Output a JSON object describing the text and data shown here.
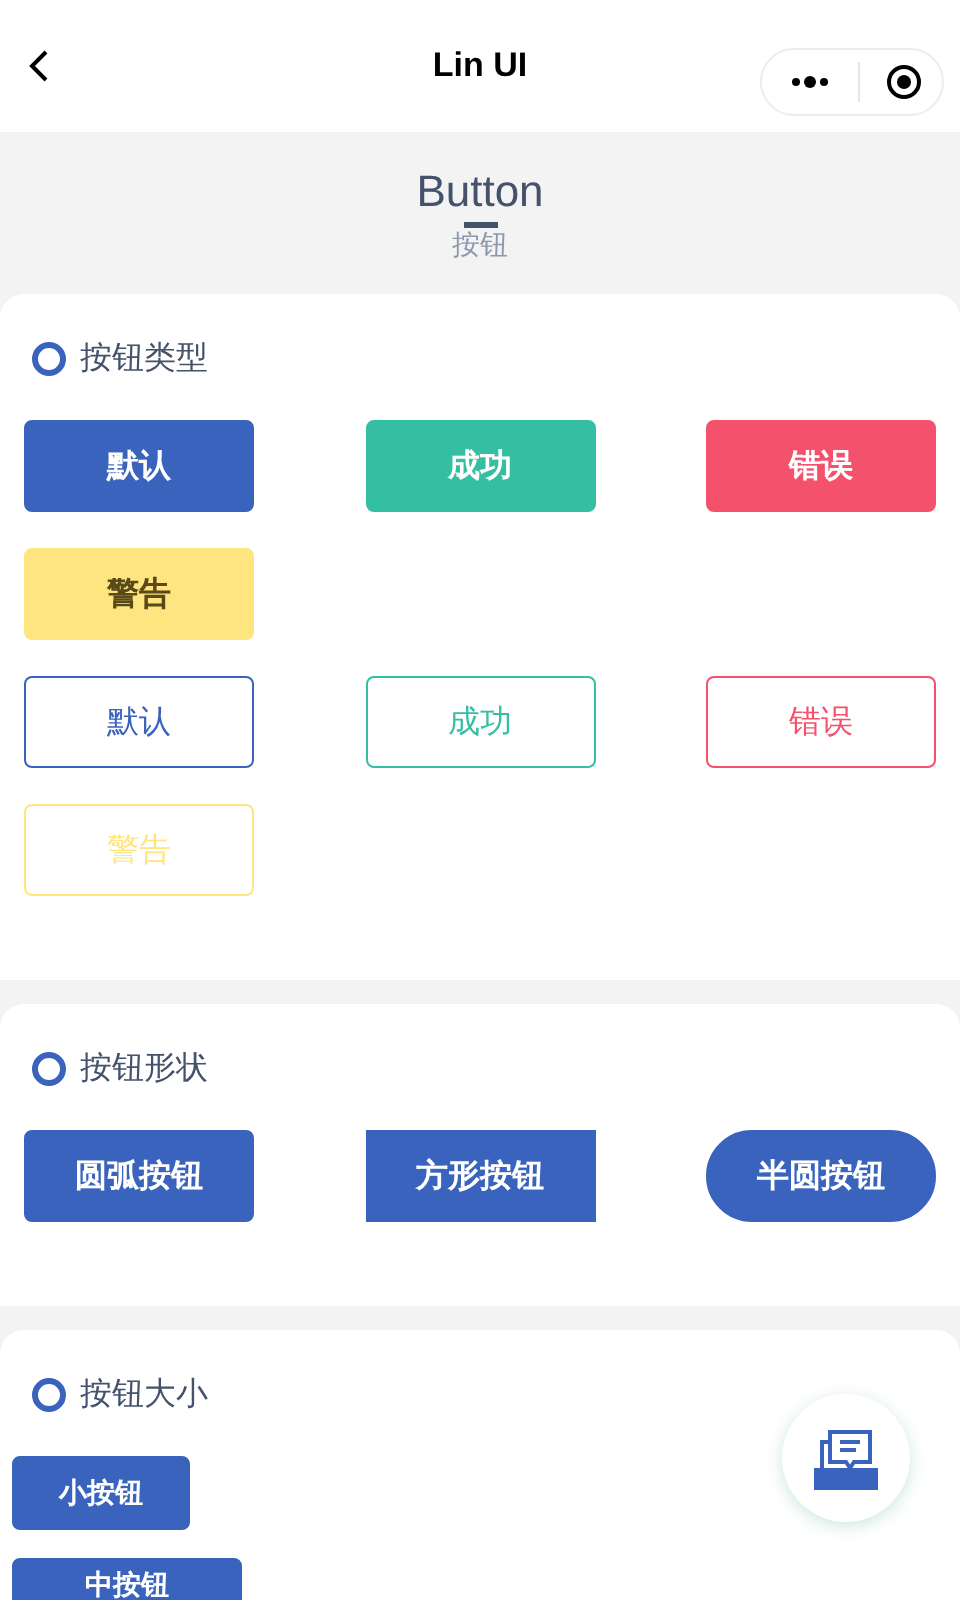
{
  "nav": {
    "title": "Lin UI"
  },
  "header": {
    "title": "Button",
    "subtitle": "按钮"
  },
  "sections": [
    {
      "title": "按钮类型",
      "rows": [
        [
          {
            "label": "默认",
            "kind": "default",
            "plain": false,
            "square": false,
            "pill": false,
            "small": false,
            "cut_off": false
          },
          {
            "label": "成功",
            "kind": "success",
            "plain": false,
            "square": false,
            "pill": false,
            "small": false,
            "cut_off": false
          },
          {
            "label": "错误",
            "kind": "error",
            "plain": false,
            "square": false,
            "pill": false,
            "small": false,
            "cut_off": false
          },
          {
            "label": "警告",
            "kind": "warning",
            "plain": false,
            "square": false,
            "pill": false,
            "small": false,
            "cut_off": false
          }
        ],
        [
          {
            "label": "默认",
            "kind": "default",
            "plain": true,
            "square": false,
            "pill": false,
            "small": false,
            "cut_off": false
          },
          {
            "label": "成功",
            "kind": "success",
            "plain": true,
            "square": false,
            "pill": false,
            "small": false,
            "cut_off": false
          },
          {
            "label": "错误",
            "kind": "error",
            "plain": true,
            "square": false,
            "pill": false,
            "small": false,
            "cut_off": false
          },
          {
            "label": "警告",
            "kind": "warning",
            "plain": true,
            "square": false,
            "pill": false,
            "small": false,
            "cut_off": false
          }
        ]
      ]
    },
    {
      "title": "按钮形状",
      "rows": [
        [
          {
            "label": "圆弧按钮",
            "kind": "default",
            "plain": false,
            "square": false,
            "pill": false,
            "small": false,
            "cut_off": false
          },
          {
            "label": "方形按钮",
            "kind": "default",
            "plain": false,
            "square": true,
            "pill": false,
            "small": false,
            "cut_off": false
          },
          {
            "label": "半圆按钮",
            "kind": "default",
            "plain": false,
            "square": false,
            "pill": true,
            "small": false,
            "cut_off": false
          }
        ]
      ]
    },
    {
      "title": "按钮大小",
      "rows": [
        [
          {
            "label": "小按钮",
            "kind": "default",
            "plain": false,
            "square": false,
            "pill": false,
            "small": true,
            "cut_off": false
          }
        ],
        [
          {
            "label": "中按钮",
            "kind": "default",
            "plain": false,
            "square": false,
            "pill": false,
            "small": false,
            "cut_off": true
          }
        ]
      ]
    }
  ]
}
